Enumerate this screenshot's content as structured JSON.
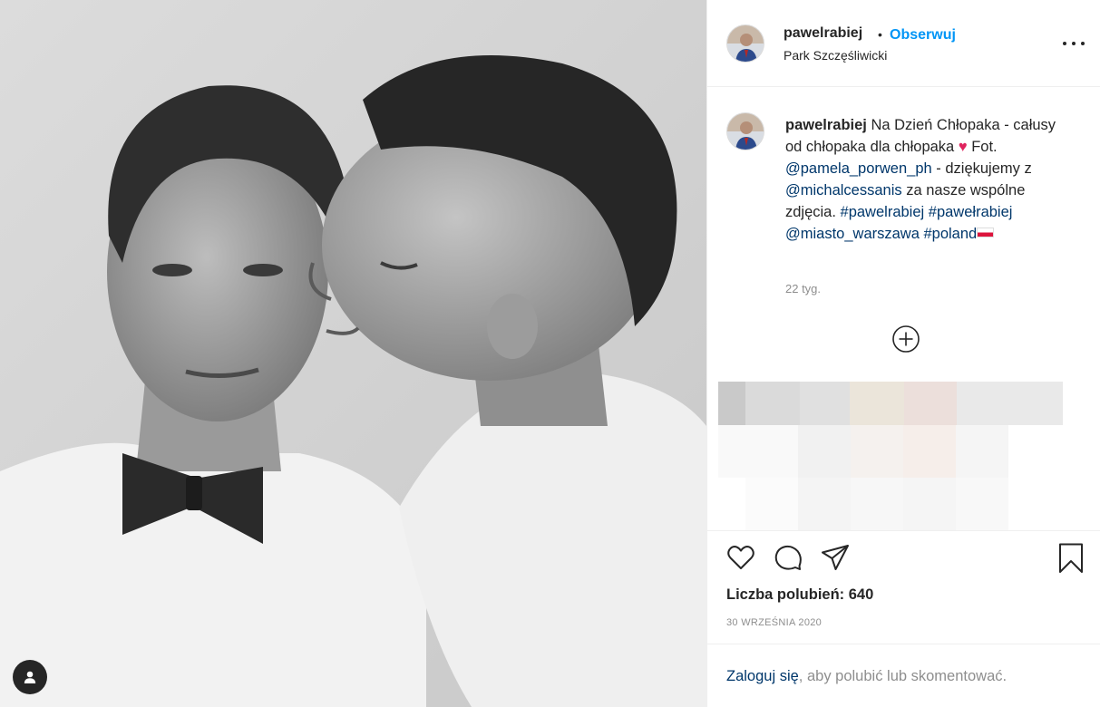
{
  "post": {
    "username": "pawelrabiej",
    "separator": "•",
    "follow_label": "Obserwuj",
    "location": "Park Szczęśliwicki"
  },
  "caption": {
    "username": "pawelrabiej",
    "text_1": " Na Dzień Chłopaka - całusy od chłopaka dla chłopaka ",
    "heart": "♥",
    "text_2": " Fot. ",
    "mention_1": "@pamela_porwen_ph",
    "text_3": " - dziękujemy z ",
    "mention_2": "@michalcessanis",
    "text_4": " za nasze wspólne zdjęcia. ",
    "hashtag_1": "#pawelrabiej",
    "hashtag_2": "#pawełrabiej",
    "mention_3": "@miasto_warszawa",
    "hashtag_3": "#poland",
    "time_ago": "22 tyg."
  },
  "engagement": {
    "likes_label": "Liczba polubień: 640",
    "date": "30 WRZEŚNIA 2020"
  },
  "login_prompt": {
    "link_label": "Zaloguj się",
    "rest": ", aby polubić lub skomentować."
  },
  "colors": {
    "accent": "#0095f6",
    "link": "#00376b",
    "secondary_text": "#8e8e8e",
    "heart": "#e0245e"
  },
  "icons": [
    "more-icon",
    "add-icon",
    "heart-icon",
    "comment-icon",
    "share-icon",
    "bookmark-icon",
    "user-tag-icon",
    "flag-poland-icon"
  ]
}
